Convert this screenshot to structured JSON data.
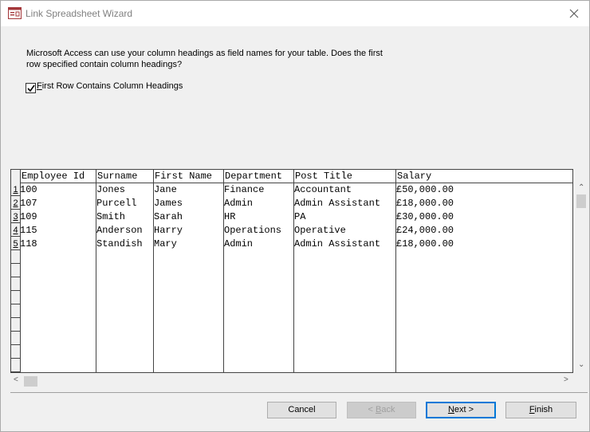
{
  "window": {
    "title": "Link Spreadsheet Wizard"
  },
  "intro": {
    "line1": "Microsoft Access can use your column headings as field names for your table. Does the first",
    "line2": "row specified contain column headings?"
  },
  "checkbox": {
    "label_accel": "F",
    "label_rest": "irst Row Contains Column Headings",
    "checked": true
  },
  "grid": {
    "columns": [
      "Employee Id",
      "Surname",
      "First Name",
      "Department",
      "Post Title",
      "Salary"
    ],
    "rows": [
      [
        "100",
        "Jones",
        "Jane",
        "Finance",
        "Accountant",
        "£50,000.00"
      ],
      [
        "107",
        "Purcell",
        "James",
        "Admin",
        "Admin Assistant",
        "£18,000.00"
      ],
      [
        "109",
        "Smith",
        "Sarah",
        "HR",
        "PA",
        "£30,000.00"
      ],
      [
        "115",
        "Anderson",
        "Harry",
        "Operations",
        "Operative",
        "£24,000.00"
      ],
      [
        "118",
        "Standish",
        "Mary",
        "Admin",
        "Admin Assistant",
        "£18,000.00"
      ]
    ],
    "row_numbers": [
      "1",
      "2",
      "3",
      "4",
      "5"
    ]
  },
  "buttons": {
    "cancel": "Cancel",
    "back_accel": "< ",
    "back_u": "B",
    "back_rest": "ack",
    "next_u": "N",
    "next_rest": "ext >",
    "finish_u": "F",
    "finish_rest": "inish"
  },
  "colors": {
    "accent": "#0078d7",
    "face": "#f0f0f0"
  }
}
